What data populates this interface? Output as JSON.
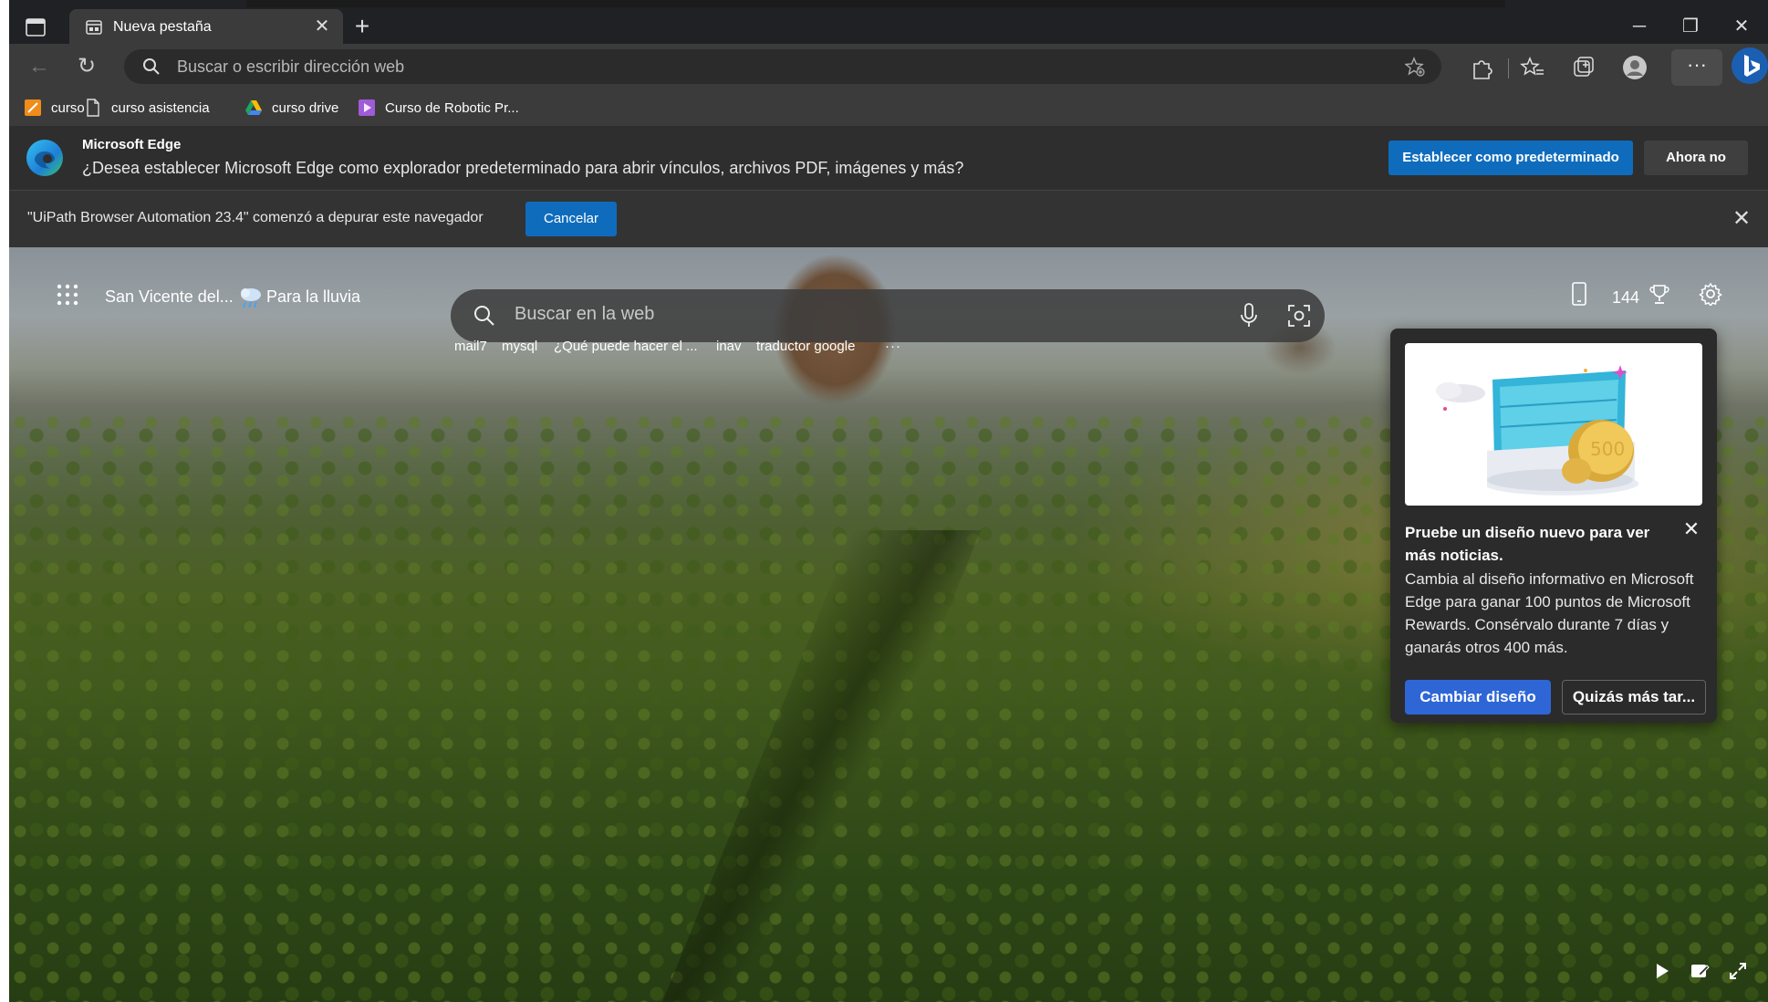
{
  "tab": {
    "title": "Nueva pestaña"
  },
  "address_bar": {
    "placeholder": "Buscar o escribir dirección web"
  },
  "favorites": [
    {
      "label": "curso",
      "icon": "orange-bookmark-icon"
    },
    {
      "label": "curso asistencia",
      "icon": "page-icon"
    },
    {
      "label": "curso drive",
      "icon": "google-drive-icon"
    },
    {
      "label": "Curso de Robotic Pr...",
      "icon": "purple-bookmark-icon"
    }
  ],
  "edge_banner": {
    "title": "Microsoft Edge",
    "message": "¿Desea establecer Microsoft Edge como explorador predeterminado para abrir vínculos, archivos PDF, imágenes y más?",
    "primary_label": "Establecer como predeterminado",
    "secondary_label": "Ahora no"
  },
  "debug_banner": {
    "message": "\"UiPath Browser Automation 23.4\" comenzó a depurar este navegador",
    "cancel_label": "Cancelar"
  },
  "newtab": {
    "location": "San Vicente del...",
    "weather": "Para la lluvia",
    "points": "144",
    "search_placeholder": "Buscar en la web",
    "quick_links": [
      "mail7",
      "mysql",
      "¿Qué puede hacer el ...",
      "inav",
      "traductor google",
      "···"
    ]
  },
  "popup": {
    "title": "Pruebe un diseño nuevo para ver más noticias.",
    "body": "Cambia al diseño informativo en Microsoft Edge para ganar 100 puntos de Microsoft Rewards. Consérvalo durante 7 días y ganarás otros 400 más.",
    "primary_label": "Cambiar diseño",
    "secondary_label": "Quizás más tar...",
    "coin_text": "500"
  },
  "colors": {
    "accent": "#0f6cbd",
    "popup_accent": "#2f66d6",
    "chrome_bg": "#202124",
    "toolbar_bg": "#3b3b3b"
  }
}
